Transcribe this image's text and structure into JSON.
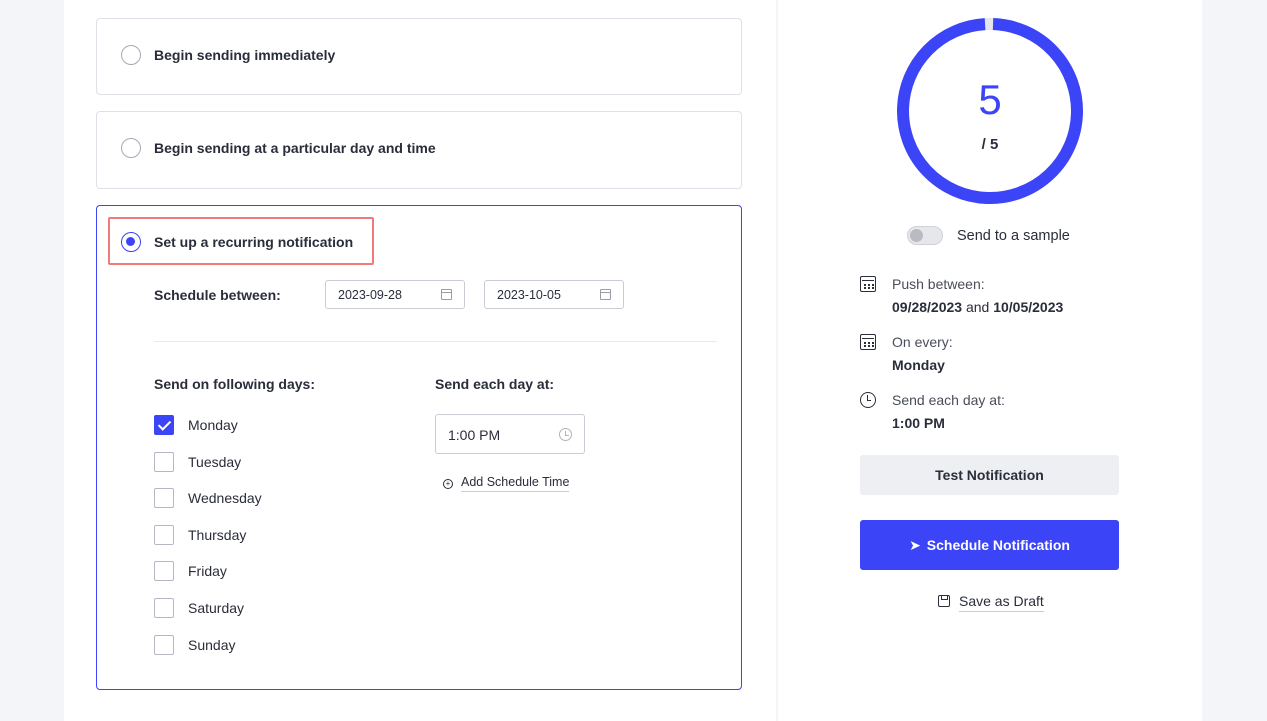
{
  "delivery_options": [
    {
      "label": "Begin sending immediately",
      "selected": false
    },
    {
      "label": "Begin sending at a particular day and time",
      "selected": false
    },
    {
      "label": "Set up a recurring notification",
      "selected": true
    }
  ],
  "recurring": {
    "schedule_label": "Schedule between:",
    "start_date": "2023-09-28",
    "end_date": "2023-10-05",
    "days_header": "Send on following days:",
    "time_header": "Send each day at:",
    "days": [
      {
        "label": "Monday",
        "checked": true
      },
      {
        "label": "Tuesday",
        "checked": false
      },
      {
        "label": "Wednesday",
        "checked": false
      },
      {
        "label": "Thursday",
        "checked": false
      },
      {
        "label": "Friday",
        "checked": false
      },
      {
        "label": "Saturday",
        "checked": false
      },
      {
        "label": "Sunday",
        "checked": false
      }
    ],
    "time_value": "1:00 PM",
    "add_time_label": "Add Schedule Time"
  },
  "summary": {
    "count": "5",
    "total": "/ 5",
    "progress_fraction": 1.0,
    "toggle_label": "Send to a sample",
    "toggle_on": false,
    "push_between_label": "Push between:",
    "push_start": "09/28/2023",
    "push_and": "and",
    "push_end": "10/05/2023",
    "on_every_label": "On every:",
    "on_every_value": "Monday",
    "send_at_label": "Send each day at:",
    "send_at_value": "1:00 PM",
    "test_button": "Test Notification",
    "schedule_button": "Schedule Notification",
    "draft_link": "Save as Draft"
  },
  "colors": {
    "accent": "#3b44f6",
    "highlight": "#ee7b7b"
  },
  "icons": [
    "calendar-icon",
    "clock-icon",
    "add-circle-icon",
    "paper-plane-icon",
    "save-icon"
  ]
}
